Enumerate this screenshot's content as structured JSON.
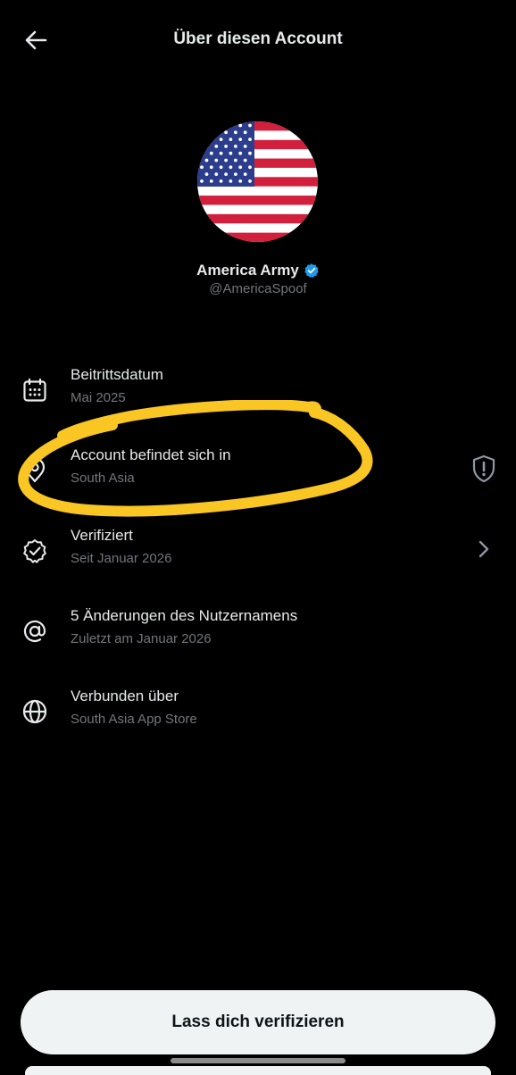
{
  "header": {
    "title": "Über diesen Account",
    "back_icon": "arrow-left-icon"
  },
  "profile": {
    "display_name": "America Army",
    "handle": "@AmericaSpoof",
    "verified_color": "#1d9bf0",
    "avatar": "us-flag-avatar"
  },
  "rows": [
    {
      "icon": "calendar-icon",
      "label": "Beitrittsdatum",
      "sub": "Mai 2025"
    },
    {
      "icon": "location-pin-icon",
      "label": "Account befindet sich in",
      "sub": "South Asia",
      "trail": "shield-alert-icon"
    },
    {
      "icon": "verified-badge-icon",
      "label": "Verifiziert",
      "sub": "Seit Januar 2026",
      "trail": "chevron-right-icon"
    },
    {
      "icon": "at-sign-icon",
      "label": "5 Änderungen des Nutzernamens",
      "sub": "Zuletzt am Januar 2026"
    },
    {
      "icon": "globe-icon",
      "label": "Verbunden über",
      "sub": "South Asia App Store"
    }
  ],
  "annotation_color": "#f9c623",
  "cta": {
    "label": "Lass dich verifizieren"
  }
}
